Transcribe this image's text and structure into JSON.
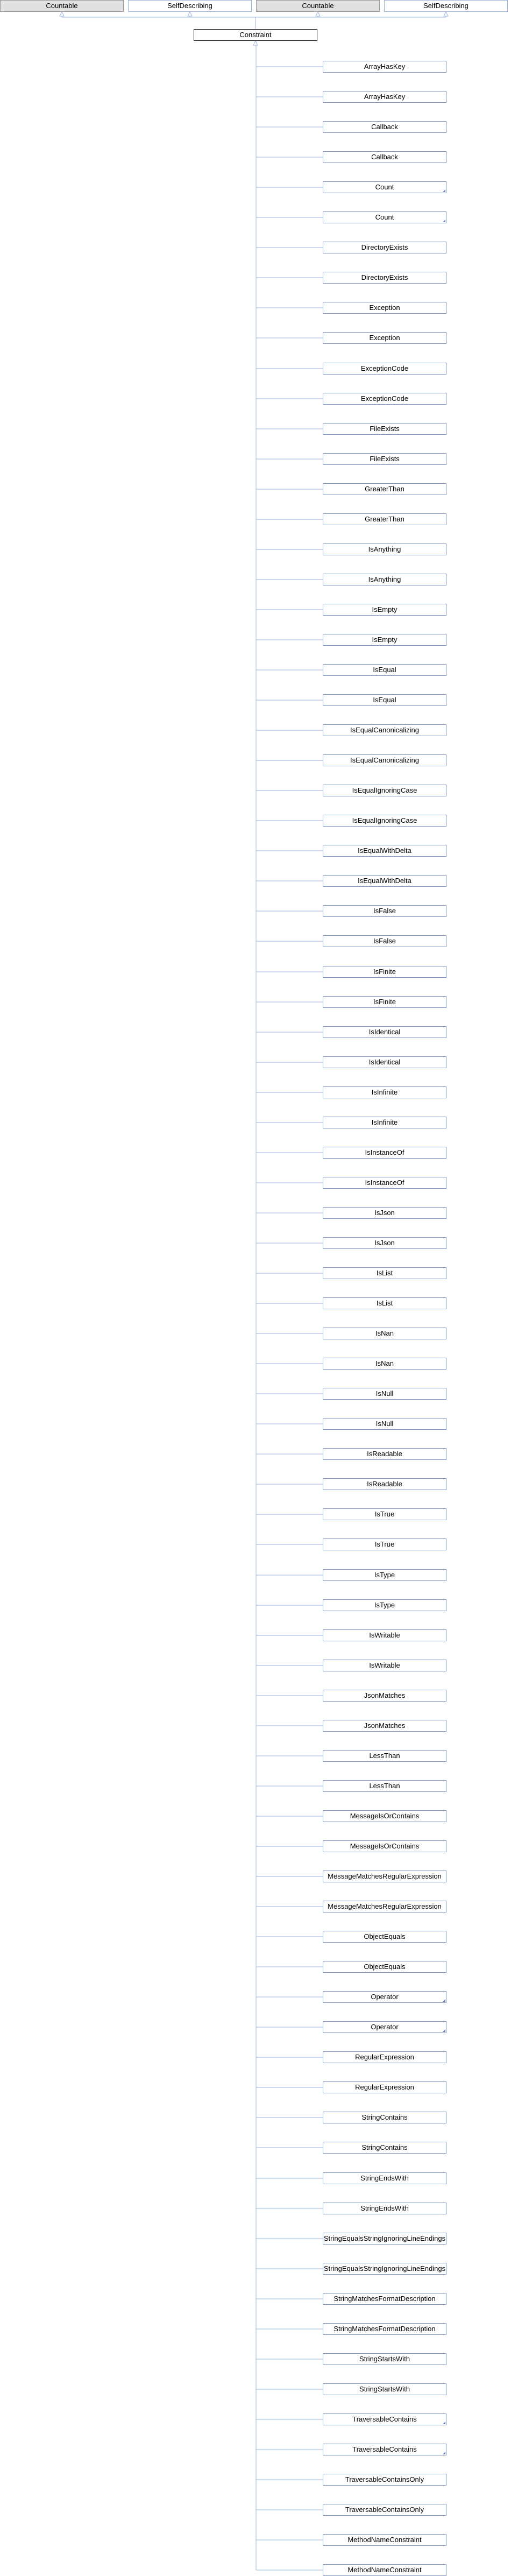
{
  "colors": {
    "edge": "#9cb5e0",
    "child_border": "#7d93c4",
    "top_gray": "#e0e0e0",
    "center_border": "#000000"
  },
  "top_nodes": [
    {
      "label": "Countable",
      "style": "gray"
    },
    {
      "label": "SelfDescribing",
      "style": "blue"
    },
    {
      "label": "Countable",
      "style": "gray"
    },
    {
      "label": "SelfDescribing",
      "style": "blue"
    }
  ],
  "center_node": {
    "label": "Constraint"
  },
  "children": [
    {
      "label": "ArrayHasKey"
    },
    {
      "label": "ArrayHasKey"
    },
    {
      "label": "Callback"
    },
    {
      "label": "Callback"
    },
    {
      "label": "Count",
      "marked": true
    },
    {
      "label": "Count",
      "marked": true
    },
    {
      "label": "DirectoryExists"
    },
    {
      "label": "DirectoryExists"
    },
    {
      "label": "Exception"
    },
    {
      "label": "Exception"
    },
    {
      "label": "ExceptionCode"
    },
    {
      "label": "ExceptionCode"
    },
    {
      "label": "FileExists"
    },
    {
      "label": "FileExists"
    },
    {
      "label": "GreaterThan"
    },
    {
      "label": "GreaterThan"
    },
    {
      "label": "IsAnything"
    },
    {
      "label": "IsAnything"
    },
    {
      "label": "IsEmpty"
    },
    {
      "label": "IsEmpty"
    },
    {
      "label": "IsEqual"
    },
    {
      "label": "IsEqual"
    },
    {
      "label": "IsEqualCanonicalizing"
    },
    {
      "label": "IsEqualCanonicalizing"
    },
    {
      "label": "IsEqualIgnoringCase"
    },
    {
      "label": "IsEqualIgnoringCase"
    },
    {
      "label": "IsEqualWithDelta"
    },
    {
      "label": "IsEqualWithDelta"
    },
    {
      "label": "IsFalse"
    },
    {
      "label": "IsFalse"
    },
    {
      "label": "IsFinite"
    },
    {
      "label": "IsFinite"
    },
    {
      "label": "IsIdentical"
    },
    {
      "label": "IsIdentical"
    },
    {
      "label": "IsInfinite"
    },
    {
      "label": "IsInfinite"
    },
    {
      "label": "IsInstanceOf"
    },
    {
      "label": "IsInstanceOf"
    },
    {
      "label": "IsJson"
    },
    {
      "label": "IsJson"
    },
    {
      "label": "IsList"
    },
    {
      "label": "IsList"
    },
    {
      "label": "IsNan"
    },
    {
      "label": "IsNan"
    },
    {
      "label": "IsNull"
    },
    {
      "label": "IsNull"
    },
    {
      "label": "IsReadable"
    },
    {
      "label": "IsReadable"
    },
    {
      "label": "IsTrue"
    },
    {
      "label": "IsTrue"
    },
    {
      "label": "IsType"
    },
    {
      "label": "IsType"
    },
    {
      "label": "IsWritable"
    },
    {
      "label": "IsWritable"
    },
    {
      "label": "JsonMatches"
    },
    {
      "label": "JsonMatches"
    },
    {
      "label": "LessThan"
    },
    {
      "label": "LessThan"
    },
    {
      "label": "MessageIsOrContains"
    },
    {
      "label": "MessageIsOrContains"
    },
    {
      "label": "MessageMatchesRegularExpression"
    },
    {
      "label": "MessageMatchesRegularExpression"
    },
    {
      "label": "ObjectEquals"
    },
    {
      "label": "ObjectEquals"
    },
    {
      "label": "Operator",
      "marked": true
    },
    {
      "label": "Operator",
      "marked": true
    },
    {
      "label": "RegularExpression"
    },
    {
      "label": "RegularExpression"
    },
    {
      "label": "StringContains"
    },
    {
      "label": "StringContains"
    },
    {
      "label": "StringEndsWith"
    },
    {
      "label": "StringEndsWith"
    },
    {
      "label": "StringEqualsStringIgnoringLineEndings"
    },
    {
      "label": "StringEqualsStringIgnoringLineEndings"
    },
    {
      "label": "StringMatchesFormatDescription"
    },
    {
      "label": "StringMatchesFormatDescription"
    },
    {
      "label": "StringStartsWith"
    },
    {
      "label": "StringStartsWith"
    },
    {
      "label": "TraversableContains",
      "marked": true
    },
    {
      "label": "TraversableContains",
      "marked": true
    },
    {
      "label": "TraversableContainsOnly"
    },
    {
      "label": "TraversableContainsOnly"
    },
    {
      "label": "MethodNameConstraint"
    },
    {
      "label": "MethodNameConstraint"
    }
  ]
}
